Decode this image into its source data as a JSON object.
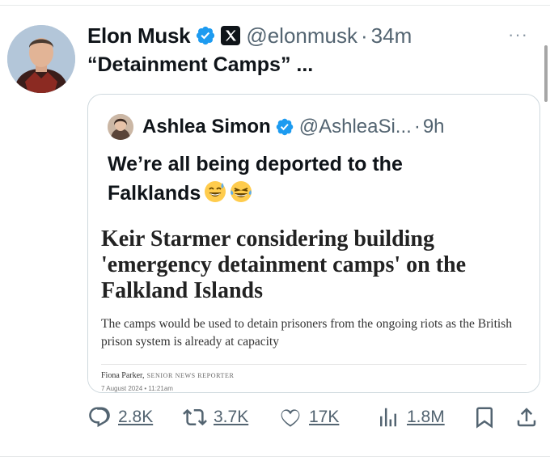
{
  "tweet": {
    "author_name": "Elon Musk",
    "author_handle": "@elonmusk",
    "separator": "·",
    "time": "34m",
    "more": "···",
    "text": "“Detainment Camps” ..."
  },
  "quoted_tweet": {
    "author_name": "Ashlea Simon",
    "author_handle": "@AshleaSi...",
    "separator": "·",
    "time": "9h",
    "text": "We’re all being deported to the Falklands",
    "emojis": [
      "sweat-smile-emoji",
      "joy-emoji"
    ]
  },
  "article": {
    "headline": "Keir Starmer considering building 'emergency detainment camps' on the Falkland Islands",
    "standfirst": "The camps would be used to detain prisoners from the ongoing riots as the British prison system is already at capacity",
    "byline_name": "Fiona Parker,",
    "byline_role": "SENIOR NEWS REPORTER",
    "date": "7 August 2024 • 11:21am"
  },
  "actions": {
    "replies": "2.8K",
    "reposts": "3.7K",
    "likes": "17K",
    "views": "1.8M"
  },
  "colors": {
    "verified": "#1d9bf0",
    "secondary_text": "#536471",
    "border": "#cfd9de"
  }
}
